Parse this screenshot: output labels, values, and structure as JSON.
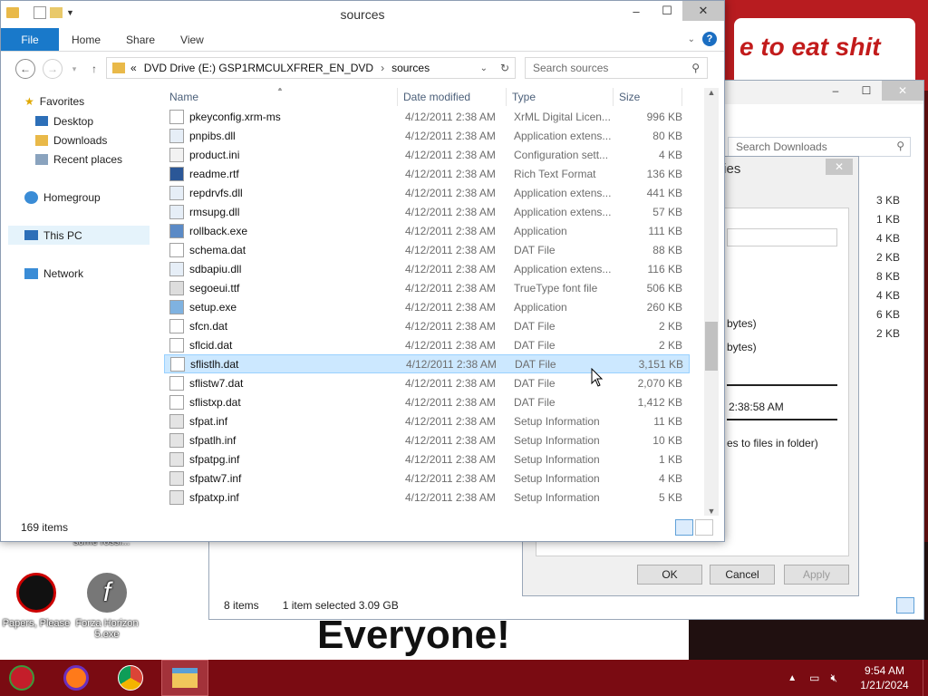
{
  "window": {
    "title": "sources",
    "ribbon_tabs": [
      "File",
      "Home",
      "Share",
      "View"
    ],
    "address": {
      "prefix": "«",
      "segments": [
        "DVD Drive (E:) GSP1RMCULXFRER_EN_DVD",
        "sources"
      ]
    },
    "search_placeholder": "Search sources",
    "status_count": "169 items"
  },
  "nav": {
    "favorites_label": "Favorites",
    "favorites": [
      "Desktop",
      "Downloads",
      "Recent places"
    ],
    "homegroup": "Homegroup",
    "this_pc": "This PC",
    "network": "Network"
  },
  "columns": {
    "name": "Name",
    "date": "Date modified",
    "type": "Type",
    "size": "Size"
  },
  "files": [
    {
      "name": "pkeyconfig.xrm-ms",
      "date": "4/12/2011 2:38 AM",
      "type": "XrML Digital Licen...",
      "size": "996 KB",
      "icon": "file-icon"
    },
    {
      "name": "pnpibs.dll",
      "date": "4/12/2011 2:38 AM",
      "type": "Application extens...",
      "size": "80 KB",
      "icon": "dll-icon"
    },
    {
      "name": "product.ini",
      "date": "4/12/2011 2:38 AM",
      "type": "Configuration sett...",
      "size": "4 KB",
      "icon": "ini-icon"
    },
    {
      "name": "readme.rtf",
      "date": "4/12/2011 2:38 AM",
      "type": "Rich Text Format",
      "size": "136 KB",
      "icon": "word-icon"
    },
    {
      "name": "repdrvfs.dll",
      "date": "4/12/2011 2:38 AM",
      "type": "Application extens...",
      "size": "441 KB",
      "icon": "dll-icon"
    },
    {
      "name": "rmsupg.dll",
      "date": "4/12/2011 2:38 AM",
      "type": "Application extens...",
      "size": "57 KB",
      "icon": "dll-icon"
    },
    {
      "name": "rollback.exe",
      "date": "4/12/2011 2:38 AM",
      "type": "Application",
      "size": "111 KB",
      "icon": "exe-icon"
    },
    {
      "name": "schema.dat",
      "date": "4/12/2011 2:38 AM",
      "type": "DAT File",
      "size": "88 KB",
      "icon": "file-icon"
    },
    {
      "name": "sdbapiu.dll",
      "date": "4/12/2011 2:38 AM",
      "type": "Application extens...",
      "size": "116 KB",
      "icon": "dll-icon"
    },
    {
      "name": "segoeui.ttf",
      "date": "4/12/2011 2:38 AM",
      "type": "TrueType font file",
      "size": "506 KB",
      "icon": "font-icon"
    },
    {
      "name": "setup.exe",
      "date": "4/12/2011 2:38 AM",
      "type": "Application",
      "size": "260 KB",
      "icon": "setup-icon"
    },
    {
      "name": "sfcn.dat",
      "date": "4/12/2011 2:38 AM",
      "type": "DAT File",
      "size": "2 KB",
      "icon": "file-icon"
    },
    {
      "name": "sflcid.dat",
      "date": "4/12/2011 2:38 AM",
      "type": "DAT File",
      "size": "2 KB",
      "icon": "file-icon"
    },
    {
      "name": "sflistlh.dat",
      "date": "4/12/2011 2:38 AM",
      "type": "DAT File",
      "size": "3,151 KB",
      "icon": "file-icon",
      "selected": true
    },
    {
      "name": "sflistw7.dat",
      "date": "4/12/2011 2:38 AM",
      "type": "DAT File",
      "size": "2,070 KB",
      "icon": "file-icon"
    },
    {
      "name": "sflistxp.dat",
      "date": "4/12/2011 2:38 AM",
      "type": "DAT File",
      "size": "1,412 KB",
      "icon": "file-icon"
    },
    {
      "name": "sfpat.inf",
      "date": "4/12/2011 2:38 AM",
      "type": "Setup Information",
      "size": "11 KB",
      "icon": "inf-icon"
    },
    {
      "name": "sfpatlh.inf",
      "date": "4/12/2011 2:38 AM",
      "type": "Setup Information",
      "size": "10 KB",
      "icon": "inf-icon"
    },
    {
      "name": "sfpatpg.inf",
      "date": "4/12/2011 2:38 AM",
      "type": "Setup Information",
      "size": "1 KB",
      "icon": "inf-icon"
    },
    {
      "name": "sfpatw7.inf",
      "date": "4/12/2011 2:38 AM",
      "type": "Setup Information",
      "size": "4 KB",
      "icon": "inf-icon"
    },
    {
      "name": "sfpatxp.inf",
      "date": "4/12/2011 2:38 AM",
      "type": "Setup Information",
      "size": "5 KB",
      "icon": "inf-icon"
    }
  ],
  "bg_window": {
    "search_placeholder": "Search Downloads",
    "sizes": [
      "3 KB",
      "1 KB",
      "4 KB",
      "2 KB",
      "8 KB",
      "4 KB",
      "6 KB",
      "2 KB"
    ],
    "status_count": "8 items",
    "status_selected": "1 item selected  3.09 GB"
  },
  "properties": {
    "title_fragment": "rties",
    "line1": "bytes)",
    "line2": "bytes)",
    "time": "2:38:58 AM",
    "attr_text": "es to files in folder)",
    "ok": "OK",
    "cancel": "Cancel",
    "apply": "Apply"
  },
  "wallpaper": {
    "sign_text": "e to eat shit",
    "banner_text": "Everyone!"
  },
  "desktop_icons": [
    {
      "label": "some rossi..."
    },
    {
      "label": "Papers, Please"
    },
    {
      "label": "Forza Horizon 5.exe"
    }
  ],
  "clock": {
    "time": "9:54 AM",
    "date": "1/21/2024"
  },
  "colors": {
    "accent": "#1979ca",
    "selection": "#cce8ff",
    "taskbar": "#7a0b12"
  }
}
